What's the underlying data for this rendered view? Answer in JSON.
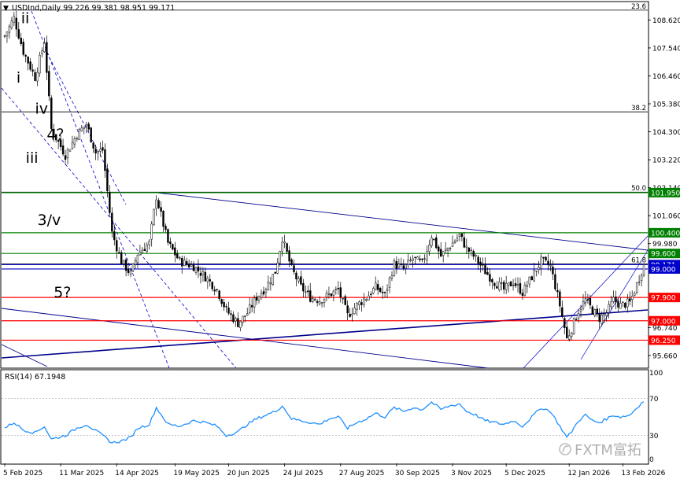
{
  "chart_data": {
    "type": "candlestick",
    "symbol_header": "USDInd,Daily  99.226 99.381 98.951 99.171",
    "ylim": [
      95.2,
      109.3
    ],
    "y_ticks": [
      "108.620",
      "107.540",
      "106.460",
      "105.380",
      "104.300",
      "103.220",
      "102.140",
      "101.060",
      "99.980",
      "96.740",
      "95.660"
    ],
    "x_ticks": [
      {
        "label": "5 Feb 2025",
        "i": 0
      },
      {
        "label": "11 Mar 2025",
        "i": 24
      },
      {
        "label": "14 Apr 2025",
        "i": 48
      },
      {
        "label": "19 May 2025",
        "i": 73
      },
      {
        "label": "20 Jun 2025",
        "i": 96
      },
      {
        "label": "24 Jul 2025",
        "i": 120
      },
      {
        "label": "27 Aug 2025",
        "i": 144
      },
      {
        "label": "30 Sep 2025",
        "i": 168
      },
      {
        "label": "3 Nov 2025",
        "i": 192
      },
      {
        "label": "5 Dec 2025",
        "i": 215
      },
      {
        "label": "12 Jan 2026",
        "i": 242
      },
      {
        "label": "13 Feb 2026",
        "i": 265
      }
    ],
    "num_bars": 275,
    "price_path": [
      [
        0,
        108.0
      ],
      [
        4,
        108.7
      ],
      [
        8,
        107.4
      ],
      [
        13,
        106.4
      ],
      [
        17,
        107.8
      ],
      [
        20,
        104.4
      ],
      [
        26,
        103.4
      ],
      [
        31,
        104.2
      ],
      [
        35,
        104.6
      ],
      [
        39,
        103.5
      ],
      [
        42,
        103.6
      ],
      [
        46,
        100.4
      ],
      [
        50,
        99.3
      ],
      [
        54,
        98.8
      ],
      [
        57,
        99.6
      ],
      [
        62,
        100.0
      ],
      [
        65,
        101.8
      ],
      [
        70,
        100.0
      ],
      [
        75,
        99.3
      ],
      [
        81,
        99.1
      ],
      [
        86,
        98.7
      ],
      [
        91,
        98.2
      ],
      [
        95,
        97.4
      ],
      [
        100,
        96.9
      ],
      [
        104,
        97.3
      ],
      [
        108,
        97.9
      ],
      [
        112,
        98.3
      ],
      [
        116,
        98.9
      ],
      [
        119,
        100.2
      ],
      [
        123,
        99.0
      ],
      [
        127,
        98.3
      ],
      [
        131,
        97.9
      ],
      [
        135,
        97.8
      ],
      [
        139,
        98.0
      ],
      [
        143,
        98.2
      ],
      [
        147,
        97.2
      ],
      [
        151,
        97.6
      ],
      [
        155,
        97.9
      ],
      [
        159,
        98.3
      ],
      [
        163,
        98.0
      ],
      [
        167,
        99.2
      ],
      [
        171,
        99.0
      ],
      [
        175,
        99.4
      ],
      [
        179,
        99.2
      ],
      [
        183,
        100.3
      ],
      [
        187,
        99.5
      ],
      [
        191,
        99.9
      ],
      [
        195,
        100.3
      ],
      [
        198,
        99.8
      ],
      [
        202,
        99.4
      ],
      [
        206,
        98.9
      ],
      [
        210,
        98.5
      ],
      [
        214,
        98.2
      ],
      [
        218,
        98.5
      ],
      [
        222,
        98.1
      ],
      [
        226,
        98.7
      ],
      [
        230,
        99.3
      ],
      [
        234,
        99.1
      ],
      [
        238,
        97.6
      ],
      [
        241,
        96.3
      ],
      [
        243,
        96.7
      ],
      [
        246,
        97.4
      ],
      [
        249,
        97.8
      ],
      [
        252,
        97.4
      ],
      [
        255,
        97.1
      ],
      [
        258,
        97.3
      ],
      [
        261,
        97.8
      ],
      [
        264,
        97.6
      ],
      [
        268,
        97.7
      ],
      [
        271,
        98.4
      ],
      [
        274,
        99.17
      ]
    ],
    "current_price": 99.171,
    "horizontal_levels": [
      {
        "price": 101.95,
        "label": "101.950",
        "color": "#008000"
      },
      {
        "price": 100.4,
        "label": "100.400",
        "color": "#008000"
      },
      {
        "price": 99.6,
        "label": "99.600",
        "color": "#008000"
      },
      {
        "price": 99.171,
        "label": "99.171",
        "color": "#0000cc"
      },
      {
        "price": 99.0,
        "label": "99.000",
        "color": "#0000cc"
      },
      {
        "price": 97.9,
        "label": "97.900",
        "color": "#ff0000"
      },
      {
        "price": 97.0,
        "label": "97.000",
        "color": "#ff0000"
      },
      {
        "price": 96.25,
        "label": "96.250",
        "color": "#ff0000"
      }
    ],
    "fibonacci": [
      {
        "price": 109.0,
        "label": "23.6"
      },
      {
        "price": 105.07,
        "label": "38.2"
      },
      {
        "price": 101.97,
        "label": "50.0"
      },
      {
        "price": 99.2,
        "label": "61.8"
      }
    ],
    "wave_labels": [
      {
        "text": "ii",
        "i": 7,
        "price": 108.5
      },
      {
        "text": "i",
        "i": 5,
        "price": 106.2
      },
      {
        "text": "iv",
        "i": 13,
        "price": 105.0
      },
      {
        "text": "4？",
        "i": 18,
        "price": 104.0
      },
      {
        "text": "iii",
        "i": 9,
        "price": 103.1
      },
      {
        "text": "3/v",
        "i": 14,
        "price": 100.7
      },
      {
        "text": "5?",
        "i": 21,
        "price": 97.9
      }
    ],
    "rsi": {
      "label": "RSI(14) 67.1948",
      "ylim": [
        0,
        100
      ],
      "ticks": [
        "100",
        "70",
        "30",
        "0"
      ],
      "path": [
        [
          0,
          38
        ],
        [
          4,
          44
        ],
        [
          8,
          36
        ],
        [
          13,
          33
        ],
        [
          17,
          40
        ],
        [
          20,
          26
        ],
        [
          26,
          30
        ],
        [
          31,
          38
        ],
        [
          35,
          42
        ],
        [
          39,
          35
        ],
        [
          42,
          30
        ],
        [
          46,
          22
        ],
        [
          50,
          24
        ],
        [
          54,
          28
        ],
        [
          57,
          38
        ],
        [
          62,
          42
        ],
        [
          65,
          60
        ],
        [
          70,
          42
        ],
        [
          75,
          40
        ],
        [
          81,
          46
        ],
        [
          86,
          44
        ],
        [
          91,
          40
        ],
        [
          95,
          30
        ],
        [
          100,
          34
        ],
        [
          104,
          42
        ],
        [
          108,
          48
        ],
        [
          112,
          52
        ],
        [
          116,
          56
        ],
        [
          119,
          62
        ],
        [
          123,
          48
        ],
        [
          127,
          46
        ],
        [
          131,
          44
        ],
        [
          135,
          42
        ],
        [
          139,
          48
        ],
        [
          143,
          50
        ],
        [
          147,
          38
        ],
        [
          151,
          44
        ],
        [
          155,
          48
        ],
        [
          159,
          54
        ],
        [
          163,
          50
        ],
        [
          167,
          60
        ],
        [
          171,
          56
        ],
        [
          175,
          60
        ],
        [
          179,
          58
        ],
        [
          183,
          66
        ],
        [
          187,
          58
        ],
        [
          191,
          62
        ],
        [
          195,
          64
        ],
        [
          198,
          56
        ],
        [
          202,
          52
        ],
        [
          206,
          46
        ],
        [
          210,
          44
        ],
        [
          214,
          42
        ],
        [
          218,
          46
        ],
        [
          222,
          40
        ],
        [
          226,
          50
        ],
        [
          230,
          60
        ],
        [
          234,
          56
        ],
        [
          238,
          40
        ],
        [
          241,
          28
        ],
        [
          243,
          34
        ],
        [
          246,
          46
        ],
        [
          249,
          52
        ],
        [
          252,
          46
        ],
        [
          255,
          44
        ],
        [
          258,
          48
        ],
        [
          261,
          52
        ],
        [
          264,
          50
        ],
        [
          268,
          52
        ],
        [
          271,
          60
        ],
        [
          274,
          67.19
        ]
      ]
    },
    "watermark": "FXTM富拓"
  }
}
